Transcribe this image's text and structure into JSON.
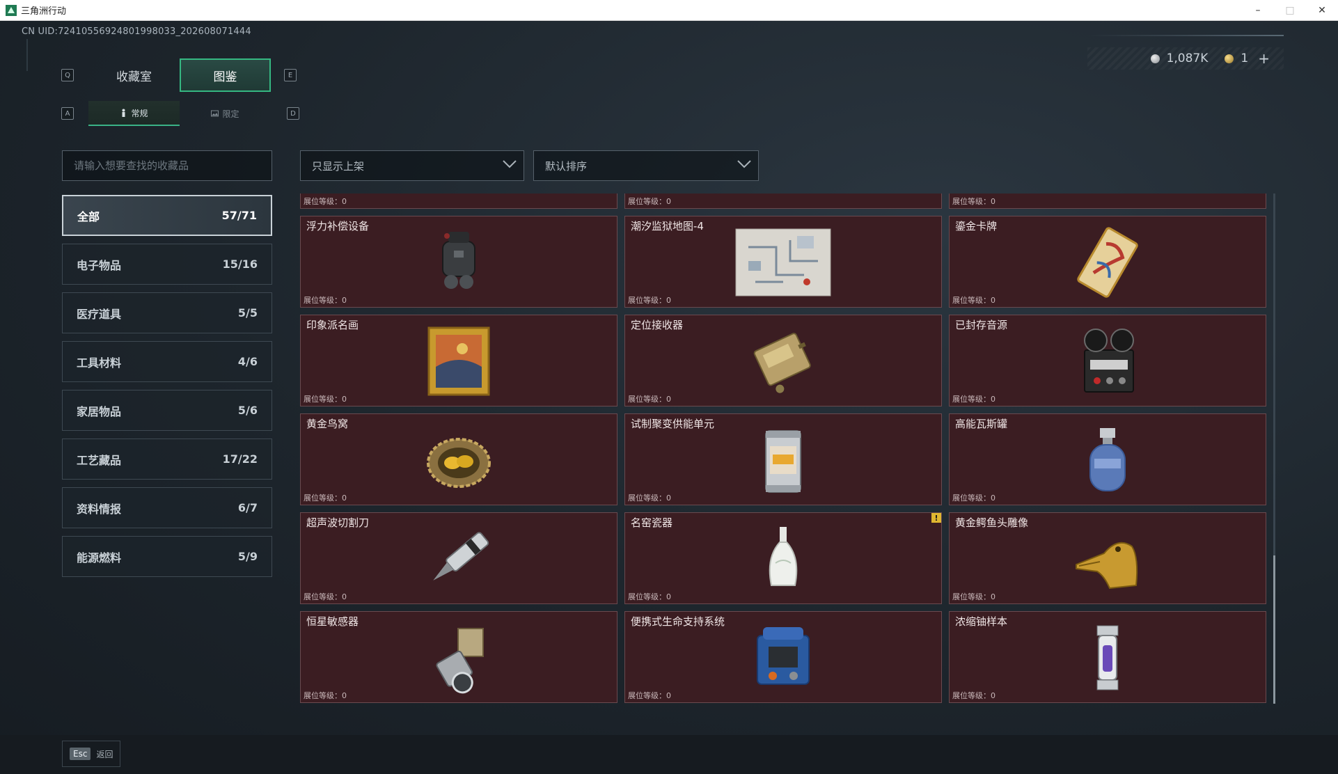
{
  "window": {
    "title": "三角洲行动",
    "minimize": "–",
    "maximize": "□",
    "close": "✕"
  },
  "uid": "CN UID:7241055692480199803​3_202608071444",
  "currency": {
    "silver": "1,087K",
    "gold": "1",
    "add": "+"
  },
  "keys": {
    "prev_tab": "Q",
    "next_tab": "E",
    "prev_sub": "A",
    "next_sub": "D"
  },
  "main_tabs": [
    {
      "label": "收藏室"
    },
    {
      "label": "图鉴"
    }
  ],
  "sub_tabs": [
    {
      "label": "常规",
      "icon": "figure-icon"
    },
    {
      "label": "限定",
      "icon": "image-icon"
    }
  ],
  "search": {
    "placeholder": "请输入想要查找的收藏品"
  },
  "filters": {
    "shelf": "只显示上架",
    "sort": "默认排序"
  },
  "categories": [
    {
      "name": "全部",
      "count": "57/71"
    },
    {
      "name": "电子物品",
      "count": "15/16"
    },
    {
      "name": "医疗道具",
      "count": "5/5"
    },
    {
      "name": "工具材料",
      "count": "4/6"
    },
    {
      "name": "家居物品",
      "count": "5/6"
    },
    {
      "name": "工艺藏品",
      "count": "17/22"
    },
    {
      "name": "资料情报",
      "count": "6/7"
    },
    {
      "name": "能源燃料",
      "count": "5/9"
    }
  ],
  "level_label": "展位等级：0",
  "items": [
    {
      "name": "浮力补偿设备",
      "icon": "bcd-backpack-icon"
    },
    {
      "name": "潮汐监狱地图-4",
      "icon": "map-icon"
    },
    {
      "name": "鎏金卡牌",
      "icon": "gilded-card-icon"
    },
    {
      "name": "印象派名画",
      "icon": "painting-icon"
    },
    {
      "name": "定位接收器",
      "icon": "receiver-icon"
    },
    {
      "name": "已封存音源",
      "icon": "reel-recorder-icon"
    },
    {
      "name": "黄金鸟窝",
      "icon": "golden-nest-icon"
    },
    {
      "name": "试制聚变供能单元",
      "icon": "fusion-unit-icon"
    },
    {
      "name": "高能瓦斯罐",
      "icon": "gas-canister-icon"
    },
    {
      "name": "超声波切割刀",
      "icon": "ultrasonic-knife-icon"
    },
    {
      "name": "名窑瓷器",
      "icon": "porcelain-vase-icon",
      "badge": "!"
    },
    {
      "name": "黄金鳄鱼头雕像",
      "icon": "golden-crocodile-icon"
    },
    {
      "name": "恒星敏感器",
      "icon": "star-sensor-icon"
    },
    {
      "name": "便携式生命支持系统",
      "icon": "life-support-icon"
    },
    {
      "name": "浓缩铀样本",
      "icon": "uranium-sample-icon"
    }
  ],
  "back": {
    "key": "Esc",
    "label": "返回"
  }
}
